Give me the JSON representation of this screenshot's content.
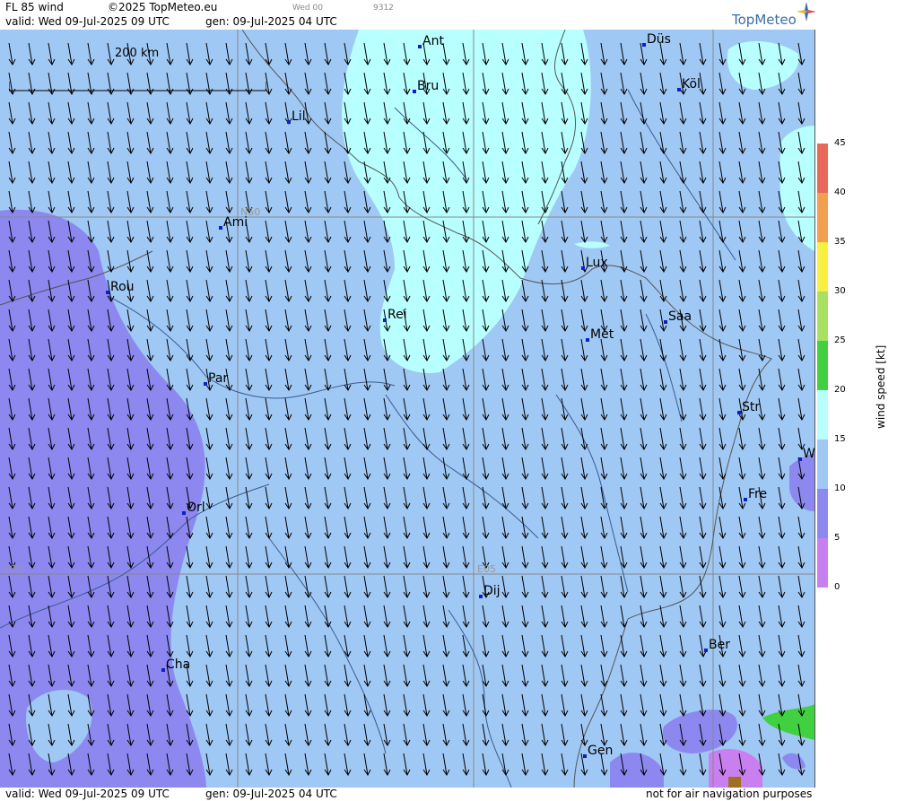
{
  "header": {
    "product": "FL 85 wind",
    "copyright": "©2025 TopMeteo.eu",
    "run": "Wed 00",
    "code": "9312",
    "valid": "valid:  Wed  09-Jul-2025  09 UTC",
    "gen": "gen: 09-Jul-2025 04 UTC",
    "logo": "TopMeteo"
  },
  "scale_bar": "200 km",
  "grid_labels": {
    "lat": "N50",
    "lon0": "E00",
    "lon5": "E05"
  },
  "cities": [
    "Ant",
    "Düs",
    "Bru",
    "Köl",
    "Lil",
    "Ami",
    "Rou",
    "Lux",
    "Rei",
    "Saa",
    "Met",
    "Par",
    "Str",
    "W",
    "Fre",
    "Orl",
    "Dij",
    "Ber",
    "Cha",
    "Gen"
  ],
  "legend": {
    "title": "wind  speed  [kt]",
    "ticks": [
      "45",
      "40",
      "35",
      "30",
      "25",
      "20",
      "15",
      "10",
      "5",
      "0"
    ],
    "colors": [
      "#e8685a",
      "#f0a050",
      "#f8f040",
      "#a8e060",
      "#40d040",
      "#b8ffff",
      "#a0c8f4",
      "#8c88f0",
      "#c880f0"
    ]
  },
  "footer": {
    "valid": "valid:  Wed  09-Jul-2025  09 UTC",
    "gen": "gen: 09-Jul-2025 04 UTC",
    "note": "not for air navigation purposes"
  }
}
